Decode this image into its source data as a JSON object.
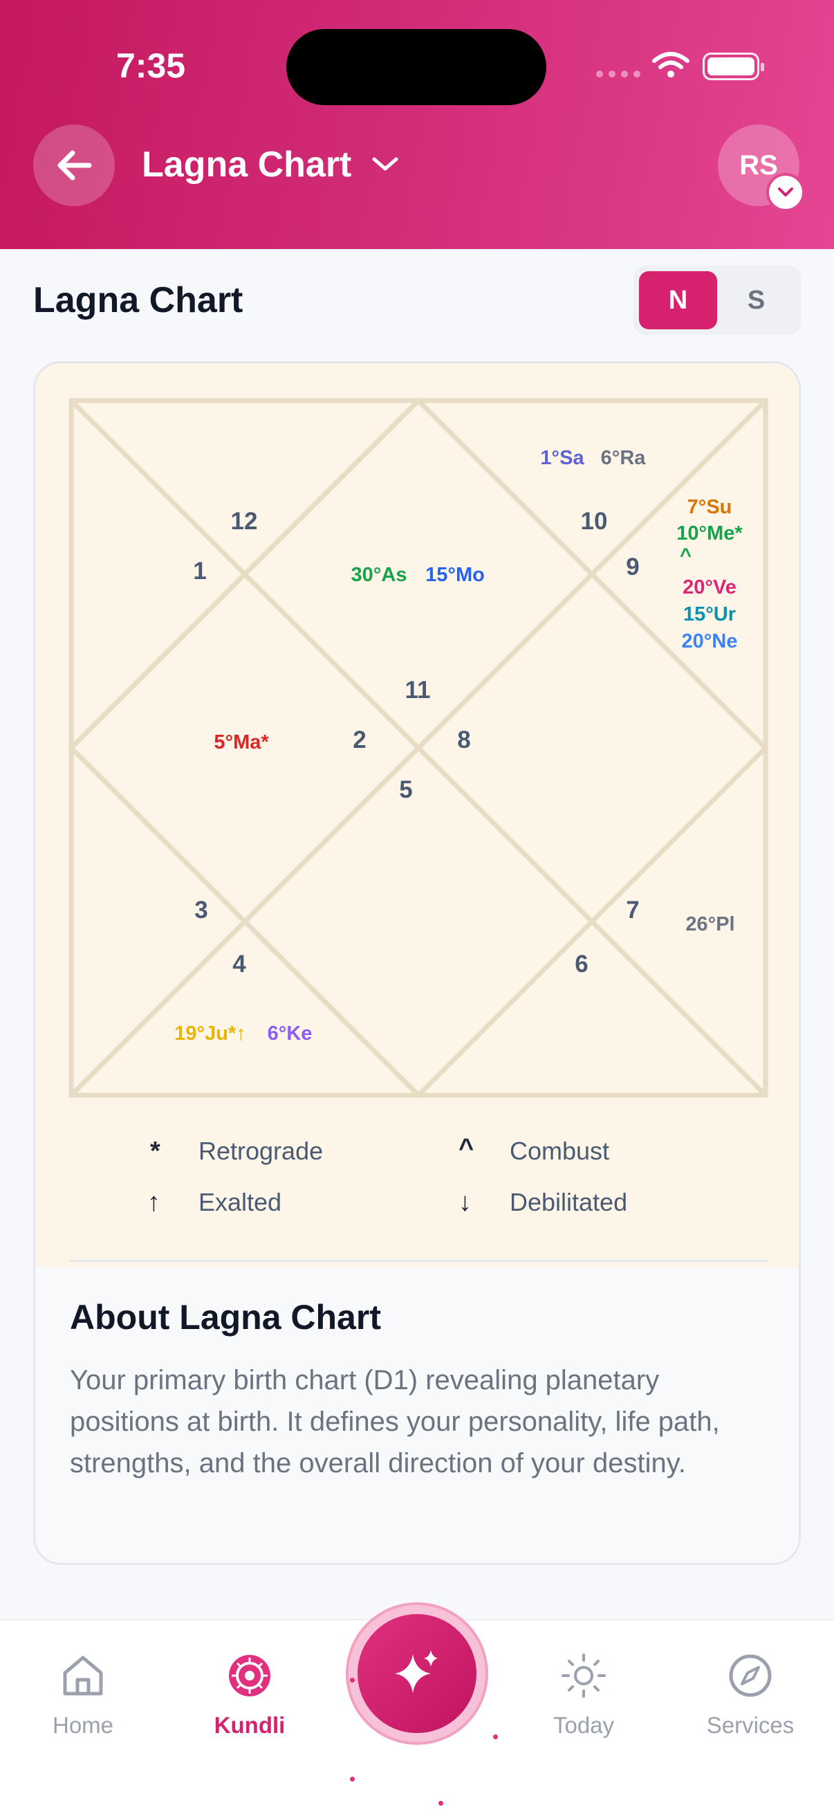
{
  "status_bar": {
    "time": "7:35"
  },
  "header": {
    "title": "Lagna Chart",
    "avatar_initials": "RS"
  },
  "section": {
    "title": "Lagna Chart",
    "toggle": {
      "north_label": "N",
      "south_label": "S",
      "selected": "N"
    }
  },
  "chart": {
    "house_numbers": [
      "12",
      "1",
      "10",
      "9",
      "11",
      "2",
      "8",
      "5",
      "3",
      "4",
      "7",
      "6"
    ],
    "planets": {
      "sa": "1°Sa",
      "ra": "6°Ra",
      "su": "7°Su",
      "me": "10°Me*",
      "me_combust": "^",
      "ve": "20°Ve",
      "ur": "15°Ur",
      "ne": "20°Ne",
      "as": "30°As",
      "mo": "15°Mo",
      "ma": "5°Ma*",
      "pl": "26°Pl",
      "ju": "19°Ju*↑",
      "ke": "6°Ke"
    },
    "colors": {
      "sa": "#5b63d3",
      "ra": "#6b7280",
      "su": "#d97706",
      "me": "#16a34a",
      "ve": "#db2777",
      "ur": "#0891b2",
      "ne": "#3b82f6",
      "as": "#16a34a",
      "mo": "#2563eb",
      "ma": "#dc2626",
      "pl": "#6b7280",
      "ju": "#eab308",
      "ke": "#8b5cf6",
      "house": "#4a5a72",
      "line": "#e8dcc4"
    }
  },
  "legend": {
    "retrograde": {
      "symbol": "*",
      "label": "Retrograde"
    },
    "combust": {
      "symbol": "^",
      "label": "Combust"
    },
    "exalted": {
      "symbol": "↑",
      "label": "Exalted"
    },
    "debilitated": {
      "symbol": "↓",
      "label": "Debilitated"
    }
  },
  "about": {
    "title": "About Lagna Chart",
    "text": "Your primary birth chart (D1) revealing planetary positions at birth. It defines your personality, life path, strengths, and the overall direction of your destiny."
  },
  "nav": {
    "home": "Home",
    "kundli": "Kundli",
    "today": "Today",
    "services": "Services",
    "active": "kundli",
    "icons": [
      "home-icon",
      "kundli-wheel-icon",
      "sparkles-icon",
      "sun-icon",
      "compass-icon"
    ]
  }
}
